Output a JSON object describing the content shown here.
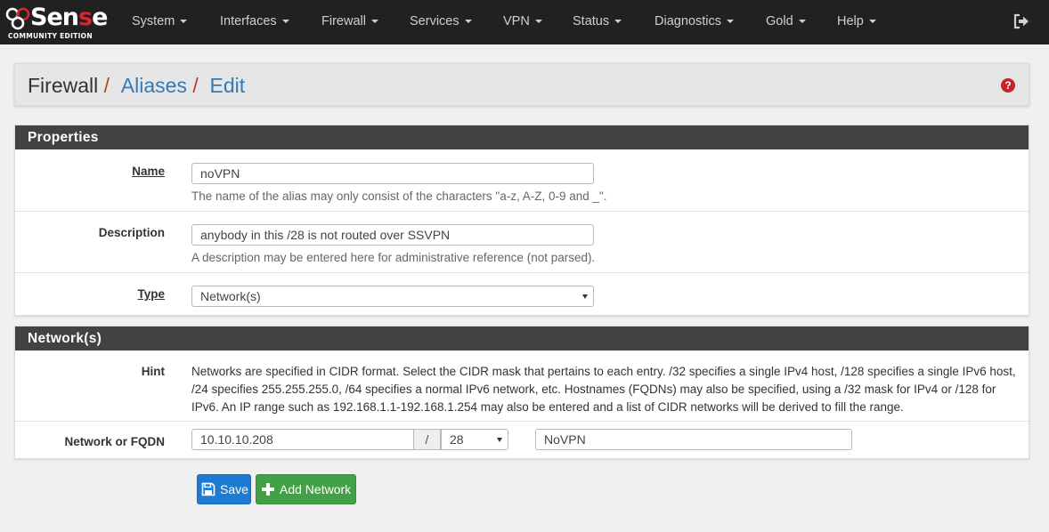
{
  "navbar": {
    "logo": {
      "main_pre": "Sen",
      "main_red": "s",
      "main_post": "e",
      "subtitle": "COMMUNITY EDITION"
    },
    "menu": [
      {
        "label": "System"
      },
      {
        "label": "Interfaces"
      },
      {
        "label": "Firewall"
      },
      {
        "label": "Services"
      },
      {
        "label": "VPN"
      },
      {
        "label": "Status"
      },
      {
        "label": "Diagnostics"
      },
      {
        "label": "Gold"
      },
      {
        "label": "Help"
      }
    ],
    "logout_icon": "sign-out-icon"
  },
  "breadcrumb": {
    "items": [
      "Firewall",
      "Aliases",
      "Edit"
    ],
    "separator": "/",
    "help_icon": "question-circle-icon"
  },
  "properties": {
    "heading": "Properties",
    "name": {
      "label": "Name",
      "value": "noVPN",
      "help": "The name of the alias may only consist of the characters \"a-z, A-Z, 0-9 and _\"."
    },
    "description": {
      "label": "Description",
      "value": "anybody in this /28 is not routed over SSVPN",
      "help": "A description may be entered here for administrative reference (not parsed)."
    },
    "type": {
      "label": "Type",
      "value": "Network(s)"
    }
  },
  "networks": {
    "heading": "Network(s)",
    "hint": {
      "label": "Hint",
      "text": "Networks are specified in CIDR format. Select the CIDR mask that pertains to each entry. /32 specifies a single IPv4 host, /128 specifies a single IPv6 host, /24 specifies 255.255.255.0, /64 specifies a normal IPv6 network, etc. Hostnames (FQDNs) may also be specified, using a /32 mask for IPv4 or /128 for IPv6. An IP range such as 192.168.1.1-192.168.1.254 may also be entered and a list of CIDR networks will be derived to fill the range."
    },
    "entry": {
      "label": "Network or FQDN",
      "address": "10.10.10.208",
      "slash": "/",
      "mask": "28",
      "description": "NoVPN"
    }
  },
  "buttons": {
    "save": {
      "label": "Save",
      "icon": "save-icon"
    },
    "add_network": {
      "label": "Add Network",
      "icon": "plus-icon"
    }
  },
  "colors": {
    "navbar_bg": "#212121",
    "panel_heading_bg": "#424242",
    "link_blue": "#337ab7",
    "separator_red": "#c0392b",
    "save_blue": "#1e7bd3",
    "add_green": "#42a046"
  }
}
